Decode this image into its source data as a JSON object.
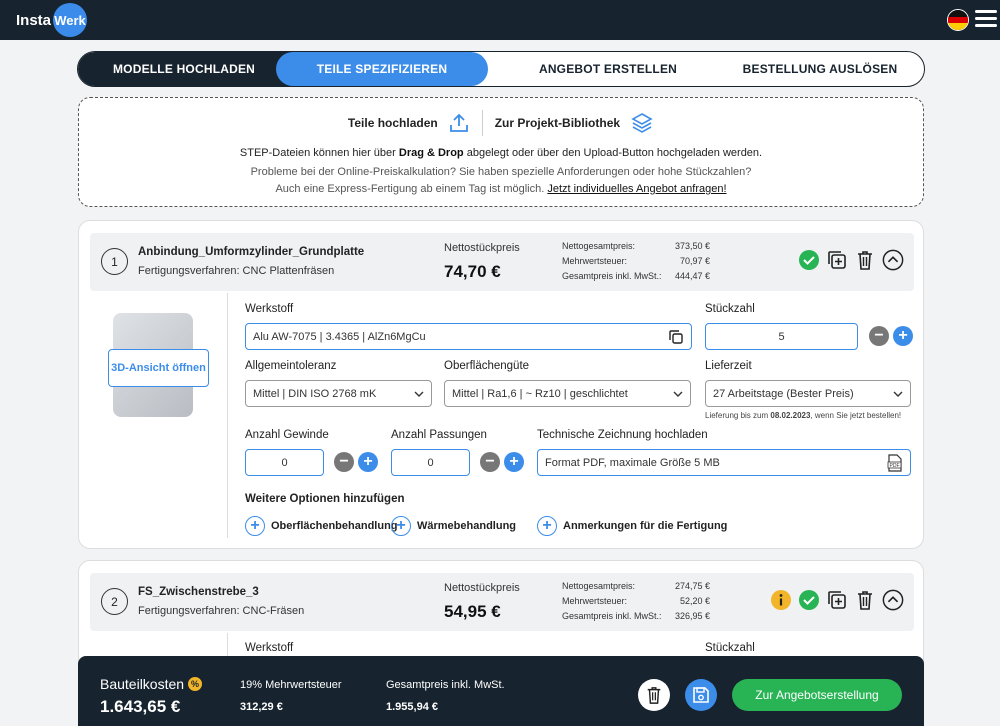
{
  "header": {
    "logo_left": "Insta",
    "logo_right": "Werk"
  },
  "steps": [
    {
      "label": "MODELLE HOCHLADEN"
    },
    {
      "label": "TEILE SPEZIFIZIEREN"
    },
    {
      "label": "ANGEBOT ERSTELLEN"
    },
    {
      "label": "BESTELLUNG AUSLÖSEN"
    }
  ],
  "upload": {
    "upload_label": "Teile hochladen",
    "library_label": "Zur Projekt-Bibliothek",
    "line1_pre": "STEP-Dateien können hier über ",
    "line1_bold": "Drag & Drop",
    "line1_post": " abgelegt oder über den Upload-Button hochgeladen werden.",
    "line2": "Probleme bei der Online-Preiskalkulation? Sie haben spezielle Anforderungen oder hohe Stückzahlen?",
    "line3_pre": "Auch eine Express-Fertigung ab einem Tag ist möglich. ",
    "line3_link": "Jetzt individuelles Angebot anfragen!"
  },
  "parts": [
    {
      "number": "1",
      "name": "Anbindung_Umformzylinder_Grundplatte",
      "process": "Fertigungsverfahren: CNC Plattenfräsen",
      "price_label": "Nettostückpreis",
      "price": "74,70 €",
      "net_label": "Nettogesamtpreis:",
      "net": "373,50 €",
      "vat_label": "Mehrwertsteuer:",
      "vat": "70,97 €",
      "gross_label": "Gesamtpreis inkl. MwSt.:",
      "gross": "444,47 €",
      "view3d": "3D-Ansicht öffnen",
      "material_label": "Werkstoff",
      "material": "Alu AW-7075 | 3.4365 | AlZn6MgCu",
      "qty_label": "Stückzahl",
      "qty": "5",
      "tolerance_label": "Allgemeintoleranz",
      "tolerance": "Mittel | DIN ISO 2768 mK",
      "surface_label": "Oberflächengüte",
      "surface": "Mittel | Ra1,6 | ~ Rz10 | geschlichtet",
      "delivery_label": "Lieferzeit",
      "delivery": "27 Arbeitstage (Bester Preis)",
      "delivery_note_pre": "Lieferung bis zum ",
      "delivery_note_date": "08.02.2023",
      "delivery_note_post": ", wenn Sie jetzt bestellen!",
      "threads_label": "Anzahl Gewinde",
      "threads": "0",
      "fits_label": "Anzahl Passungen",
      "fits": "0",
      "drawing_label": "Technische Zeichnung hochladen",
      "drawing_placeholder": "Format PDF, maximale Größe 5 MB",
      "options_label": "Weitere Optionen hinzufügen",
      "opt_surface": "Oberflächenbehandlung",
      "opt_heat": "Wärmebehandlung",
      "opt_notes": "Anmerkungen für die Fertigung"
    },
    {
      "number": "2",
      "name": "FS_Zwischenstrebe_3",
      "process": "Fertigungsverfahren: CNC-Fräsen",
      "price_label": "Nettostückpreis",
      "price": "54,95 €",
      "net_label": "Nettogesamtpreis:",
      "net": "274,75 €",
      "vat_label": "Mehrwertsteuer:",
      "vat": "52,20 €",
      "gross_label": "Gesamtpreis inkl. MwSt.:",
      "gross": "326,95 €",
      "material_label": "Werkstoff",
      "qty_label": "Stückzahl"
    }
  ],
  "footer": {
    "cost_label": "Bauteilkosten",
    "cost_value": "1.643,65 €",
    "vat_label": "19% Mehrwertsteuer",
    "vat_value": "312,29 €",
    "gross_label": "Gesamtpreis inkl. MwSt.",
    "gross_value": "1.955,94 €",
    "cta": "Zur Angebotserstellung"
  },
  "colors": {
    "dark": "#17232e",
    "accent": "#3c8dea",
    "success": "#28b455",
    "warning": "#f2b52a"
  },
  "icons": [
    "upload-icon",
    "layers-icon",
    "check-icon",
    "duplicate-icon",
    "trash-icon",
    "chevron-up-icon",
    "copy-icon",
    "pdf-icon",
    "info-icon",
    "save-icon",
    "percent-icon",
    "menu-icon",
    "flag-de-icon"
  ]
}
